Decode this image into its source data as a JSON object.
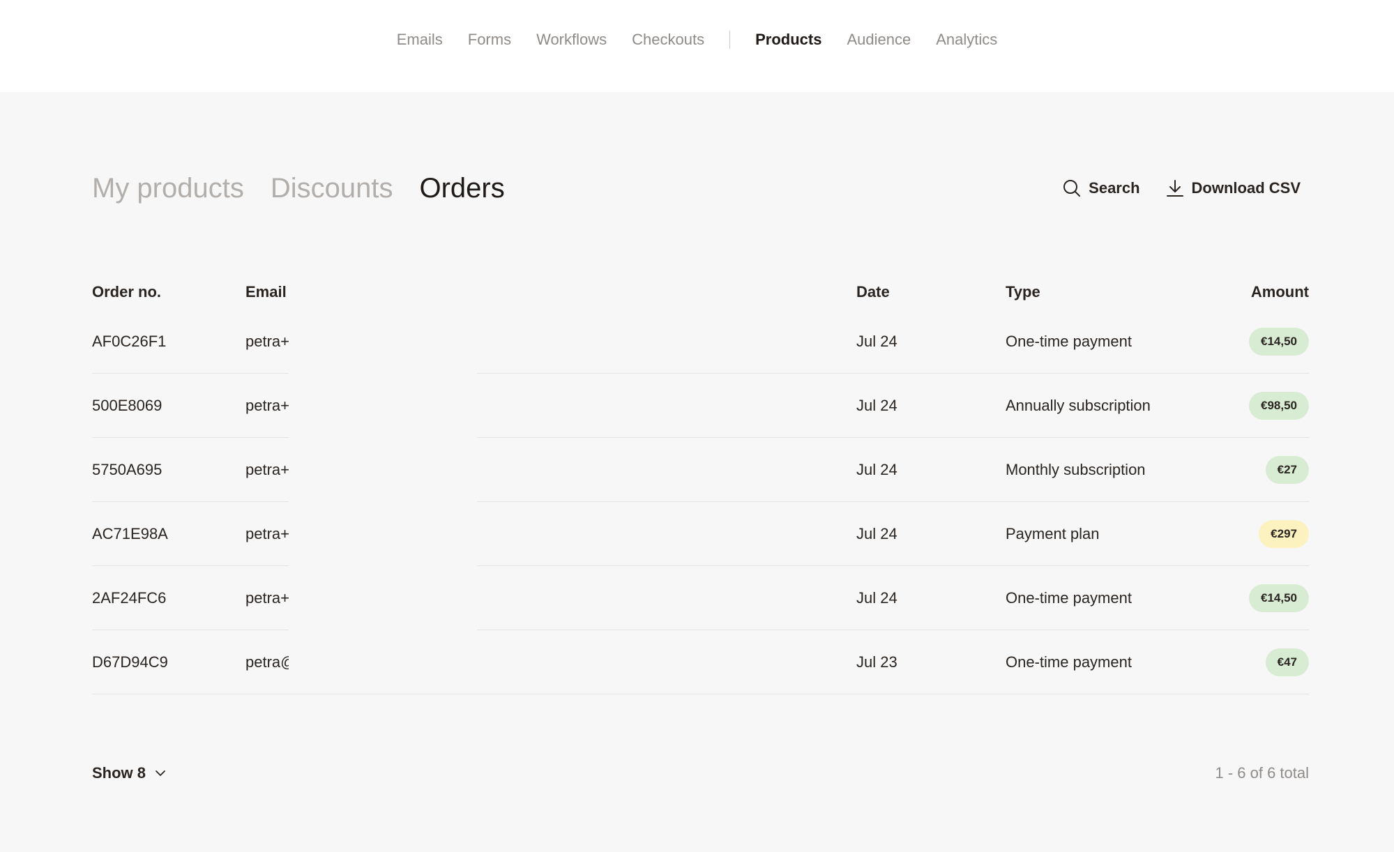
{
  "top_nav": {
    "items": [
      "Emails",
      "Forms",
      "Workflows",
      "Checkouts"
    ],
    "items_right": [
      "Products",
      "Audience",
      "Analytics"
    ],
    "active": "Products"
  },
  "sub_tabs": {
    "items": [
      "My products",
      "Discounts",
      "Orders"
    ],
    "active": "Orders"
  },
  "actions": {
    "search_label": "Search",
    "download_label": "Download CSV"
  },
  "table": {
    "headers": {
      "order_no": "Order no.",
      "email": "Email",
      "date": "Date",
      "type": "Type",
      "amount": "Amount"
    },
    "rows": [
      {
        "order_no": "AF0C26F1",
        "email": "petra+",
        "date": "Jul 24",
        "type": "One-time payment",
        "amount": "€14,50",
        "amount_color": "green"
      },
      {
        "order_no": "500E8069",
        "email": "petra+",
        "date": "Jul 24",
        "type": "Annually subscription",
        "amount": "€98,50",
        "amount_color": "green"
      },
      {
        "order_no": "5750A695",
        "email": "petra+",
        "date": "Jul 24",
        "type": "Monthly subscription",
        "amount": "€27",
        "amount_color": "green"
      },
      {
        "order_no": "AC71E98A",
        "email": "petra+",
        "date": "Jul 24",
        "type": "Payment plan",
        "amount": "€297",
        "amount_color": "yellow"
      },
      {
        "order_no": "2AF24FC6",
        "email": "petra+",
        "date": "Jul 24",
        "type": "One-time payment",
        "amount": "€14,50",
        "amount_color": "green"
      },
      {
        "order_no": "D67D94C9",
        "email": "petra@",
        "date": "Jul 23",
        "type": "One-time payment",
        "amount": "€47",
        "amount_color": "green"
      }
    ]
  },
  "footer": {
    "show_label": "Show 8",
    "pagination": "1 - 6 of 6 total"
  },
  "colors": {
    "pill_green": "#d8ecd4",
    "pill_yellow": "#fbf2c0",
    "background": "#f7f7f7"
  }
}
